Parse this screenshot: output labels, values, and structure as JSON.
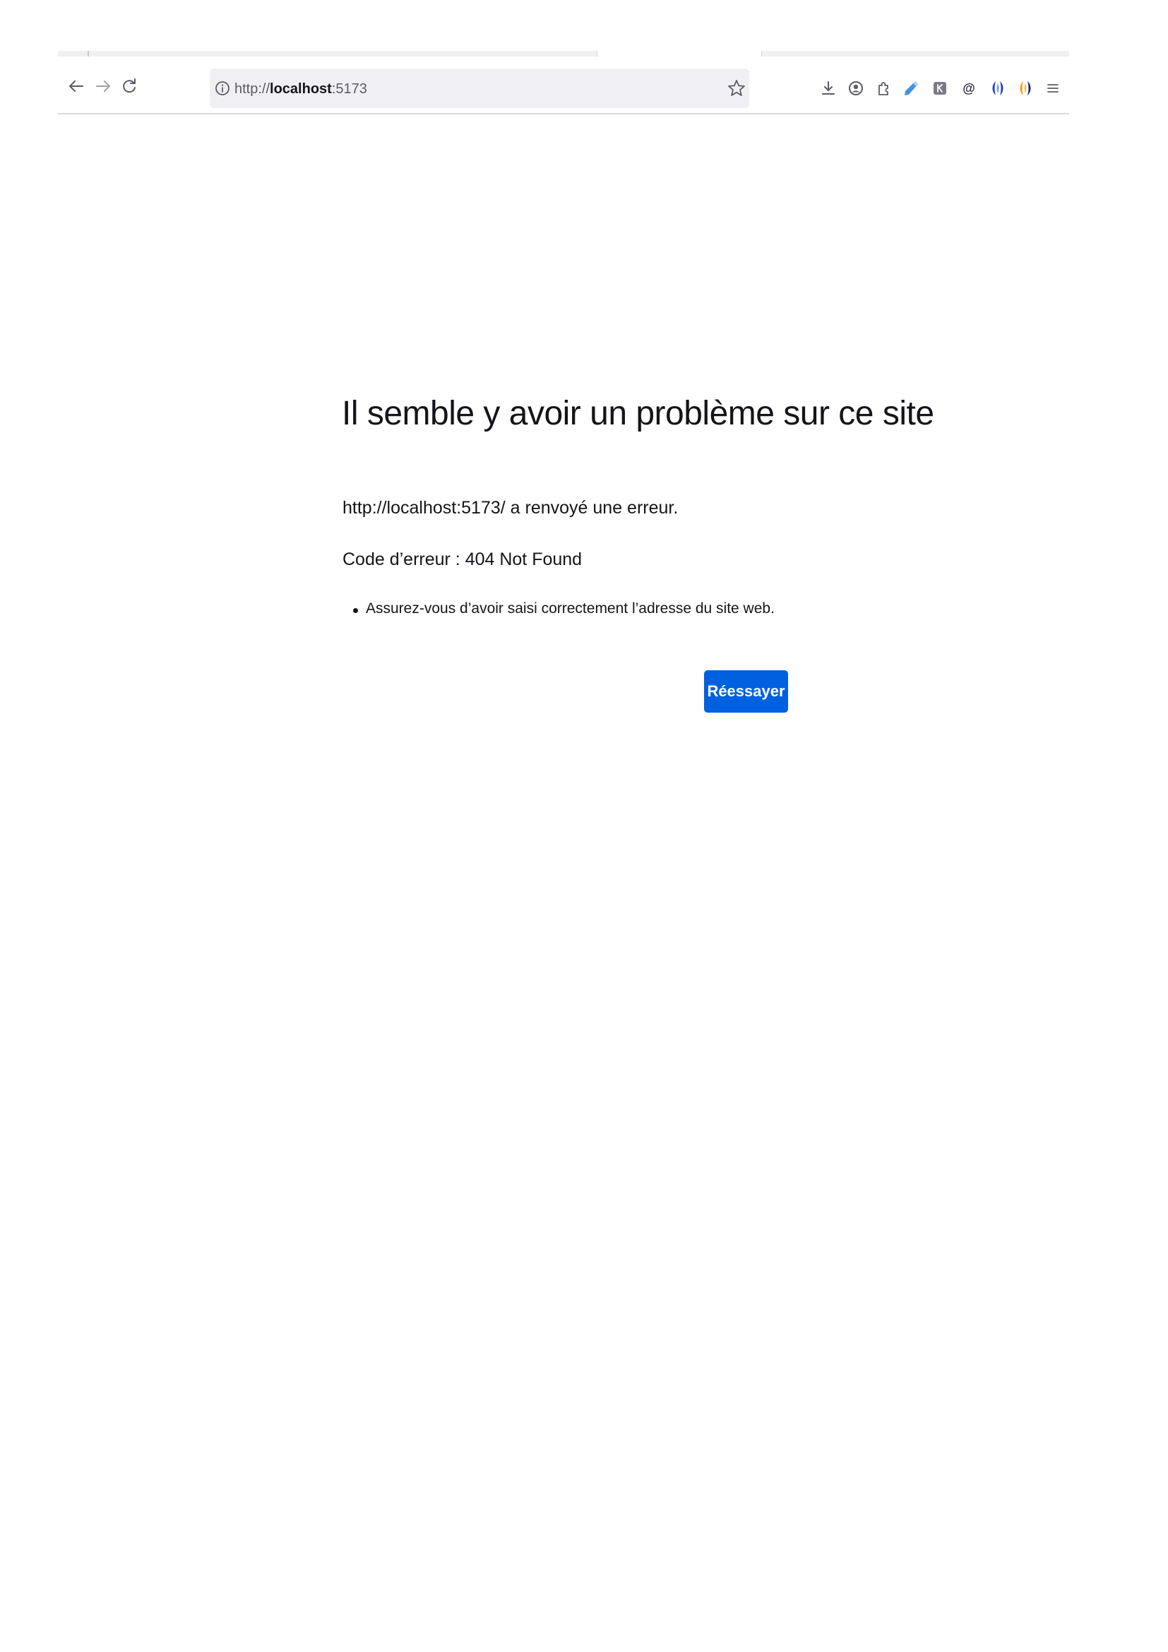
{
  "browser": {
    "url": {
      "scheme": "http://",
      "host": "localhost",
      "port": ":5173"
    },
    "toolbar_icons": [
      "back-arrow-icon",
      "forward-arrow-icon",
      "reload-icon",
      "site-info-icon",
      "bookmark-star-icon",
      "downloads-icon",
      "account-icon",
      "extensions-icon",
      "pen-extension-icon",
      "k-extension-icon",
      "at-extension-icon",
      "blue-drop-extension-icon",
      "orange-drop-extension-icon",
      "menu-icon"
    ]
  },
  "error_page": {
    "title": "Il semble y avoir un problème sur ce site",
    "message": "http://localhost:5173/ a renvoyé une erreur.",
    "error_code": "Code d’erreur : 404 Not Found",
    "suggestions": [
      "Assurez-vous d’avoir saisi correctement l’adresse du site web."
    ],
    "retry_label": "Réessayer"
  },
  "colors": {
    "accent": "#0061e0",
    "text": "#15141a",
    "urlbar_bg": "#f0f0f4"
  }
}
